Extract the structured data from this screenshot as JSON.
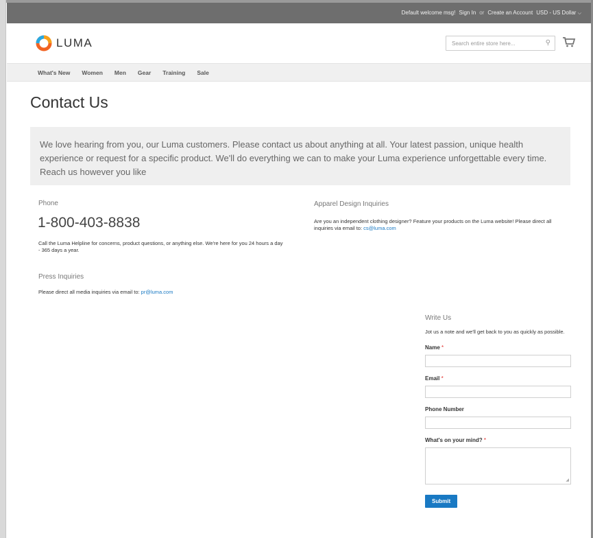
{
  "topbar": {
    "welcome": "Default welcome msg!",
    "sign_in": "Sign In",
    "or": "or",
    "create_account": "Create an Account",
    "currency": "USD - US Dollar"
  },
  "header": {
    "logo_text": "LUMA",
    "search_placeholder": "Search entire store here..."
  },
  "nav": {
    "items": [
      "What's New",
      "Women",
      "Men",
      "Gear",
      "Training",
      "Sale"
    ]
  },
  "page": {
    "title": "Contact Us",
    "intro": "We love hearing from you, our Luma customers. Please contact us about anything at all. Your latest passion, unique health experience or request for a specific product. We'll do everything we can to make your Luma experience unforgettable every time. Reach us however you like"
  },
  "phone": {
    "heading": "Phone",
    "number": "1-800-403-8838",
    "text": "Call the Luma Helpline for concerns, product questions, or anything else. We're here for you 24 hours a day - 365 days a year."
  },
  "press": {
    "heading": "Press Inquiries",
    "text": "Please direct all media inquiries via email to: ",
    "email": "pr@luma.com"
  },
  "apparel": {
    "heading": "Apparel Design Inquiries",
    "text": "Are you an independent clothing designer? Feature your products on the Luma website! Please direct all inquiries via email to: ",
    "email": "cs@luma.com"
  },
  "form": {
    "title": "Write Us",
    "note": "Jot us a note and we'll get back to you as quickly as possible.",
    "name_label": "Name",
    "email_label": "Email",
    "phone_label": "Phone Number",
    "comment_label": "What's on your mind?",
    "required_mark": "*",
    "submit_label": "Submit"
  },
  "colors": {
    "accent": "#1979c3",
    "logo_orange": "#f26322",
    "required": "#e02b27"
  }
}
